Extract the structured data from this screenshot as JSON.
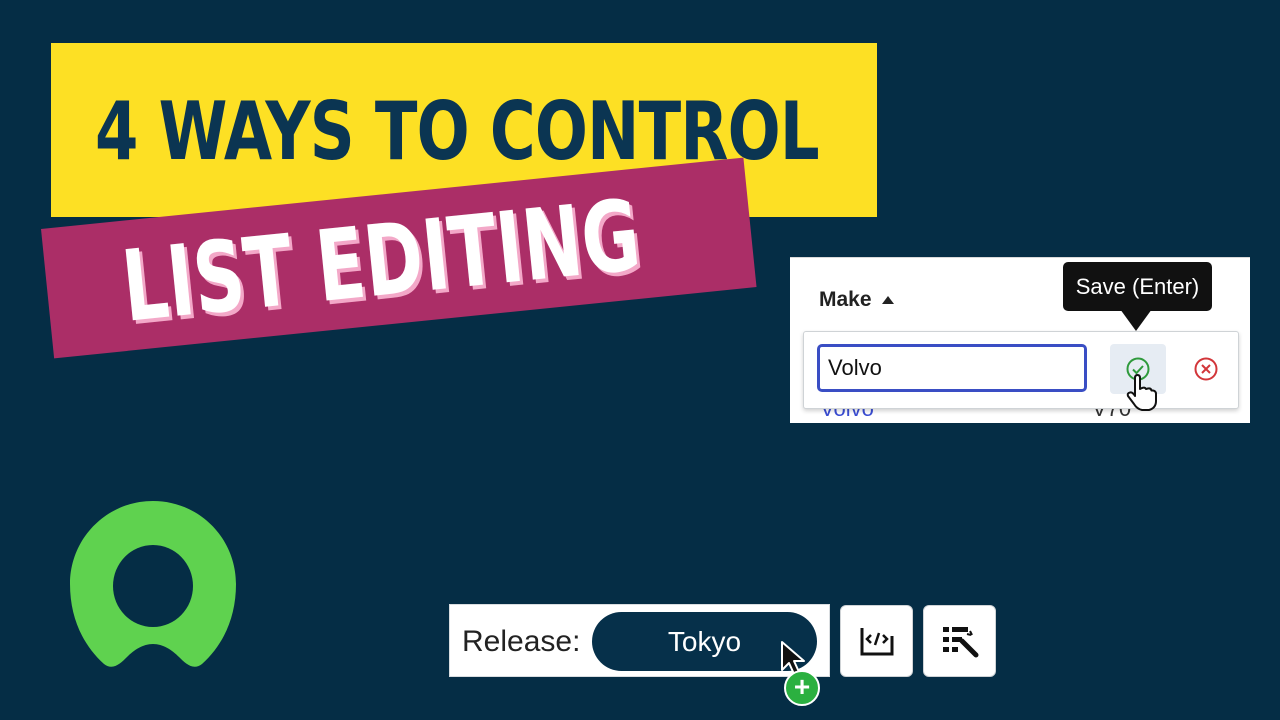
{
  "title": {
    "line1": "4 WAYS TO CONTROL",
    "line2": "LIST EDITING"
  },
  "table": {
    "column_header": "Make",
    "sort_direction": "ascending",
    "behind_row_make": "Volvo",
    "behind_row_model": "V70",
    "edit_value": "Volvo",
    "save_tooltip": "Save (Enter)"
  },
  "release": {
    "label": "Release:",
    "value": "Tokyo"
  },
  "icons": {
    "save": "check-circle-icon",
    "cancel": "x-circle-icon",
    "script_editor": "code-icon",
    "list_control": "list-wand-icon"
  },
  "colors": {
    "background": "#052d45",
    "yellow": "#fde024",
    "magenta": "#ab2e67",
    "logo_green": "#5fd24f",
    "input_focus": "#3a4ec4"
  }
}
